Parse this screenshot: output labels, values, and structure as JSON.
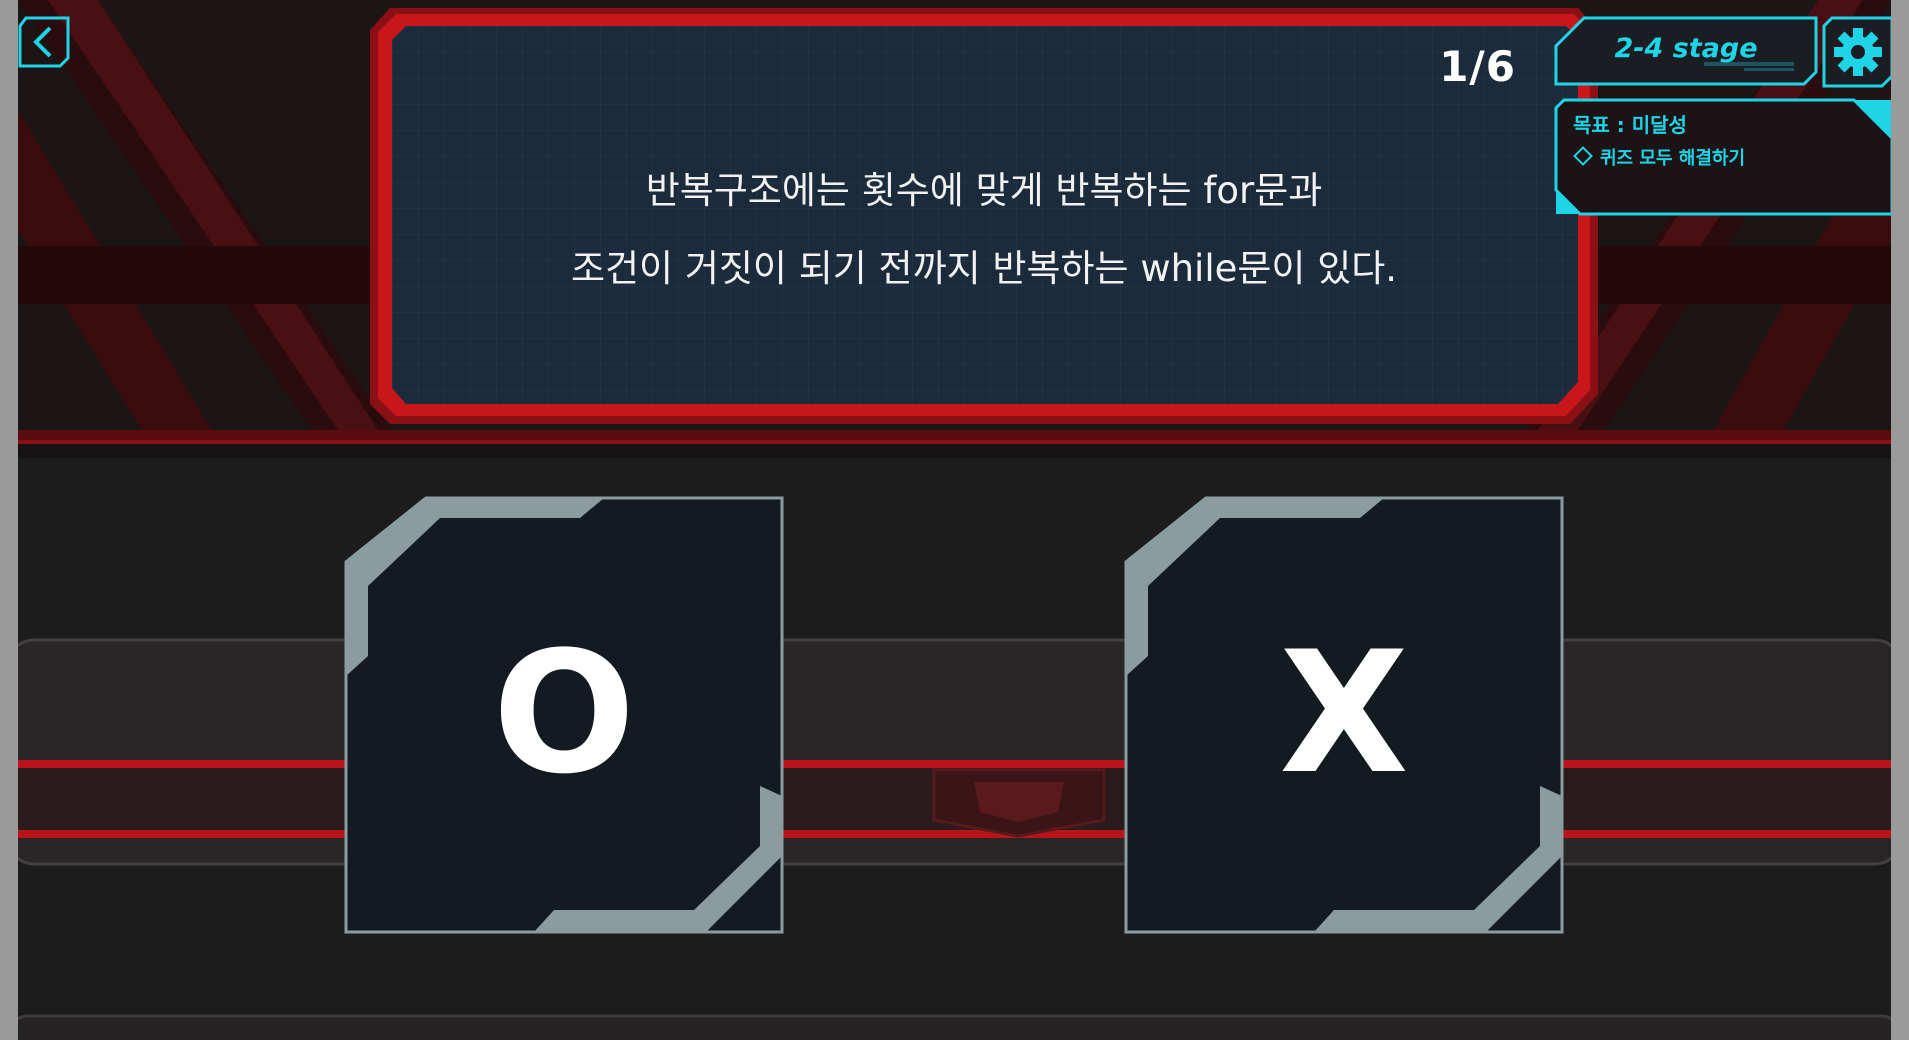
{
  "header": {
    "back_icon": "chevron-left-icon",
    "stage_label": "2-4 stage",
    "settings_icon": "gear-icon"
  },
  "question": {
    "counter": "1/6",
    "line1": "반복구조에는 횟수에 맞게 반복하는 for문과",
    "line2": "조건이 거짓이 되기 전까지 반복하는 while문이 있다."
  },
  "goal": {
    "title": "목표 : 미달성",
    "item": "퀴즈 모두 해결하기",
    "item_icon": "diamond-icon"
  },
  "answers": {
    "o_label": "O",
    "x_label": "X"
  },
  "colors": {
    "accent_red": "#c8161b",
    "accent_cyan": "#20d4e8",
    "panel_navy": "#1c2b3b",
    "card_border": "#8a9c9e",
    "card_fill": "#141a22",
    "background": "#1d1c1d"
  }
}
